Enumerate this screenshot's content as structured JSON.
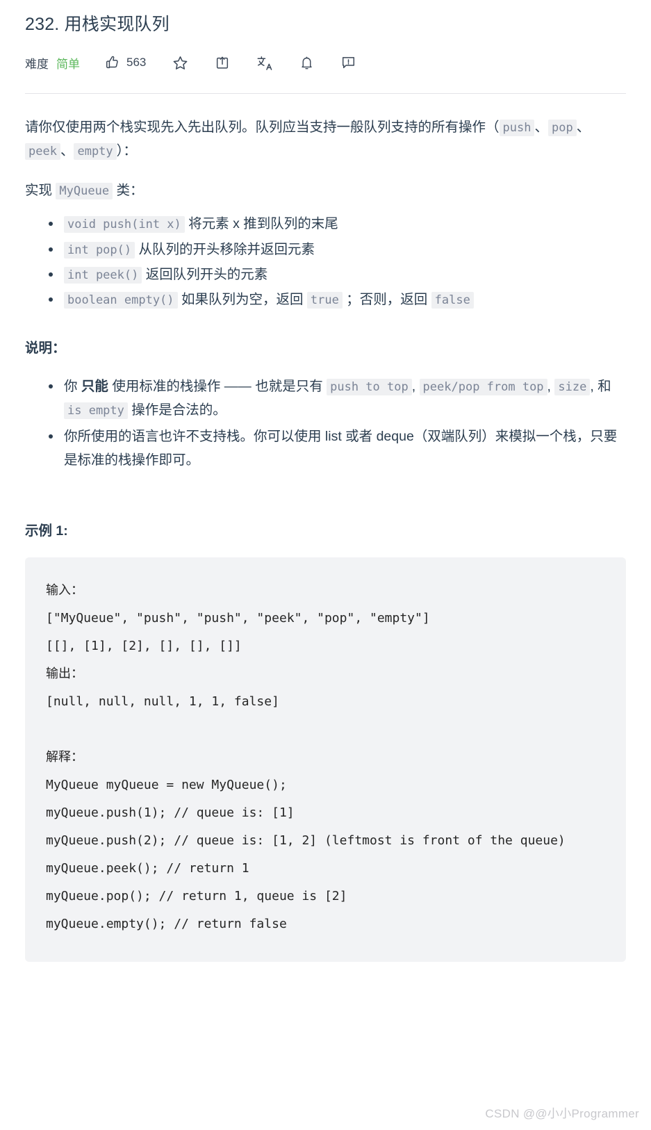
{
  "header": {
    "title": "232. 用栈实现队列",
    "difficulty_label": "难度",
    "difficulty_value": "简单",
    "difficulty_color": "#5cb85c",
    "like_count": "563",
    "icons": {
      "like": "thumbs-up-icon",
      "favorite": "star-icon",
      "share": "share-icon",
      "translate": "translate-icon",
      "notification": "bell-icon",
      "feedback": "comment-icon"
    }
  },
  "description": {
    "p1_a": "请你仅使用两个栈实现先入先出队列。队列应当支持一般队列支持的所有操作（",
    "p1_code1": "push",
    "p1_sep1": "、",
    "p1_code2": "pop",
    "p1_sep2": "、",
    "p1_code3": "peek",
    "p1_sep3": "、",
    "p1_code4": "empty",
    "p1_b": "）：",
    "p2_a": "实现 ",
    "p2_code": "MyQueue",
    "p2_b": " 类："
  },
  "methods": [
    {
      "code": "void push(int x)",
      "text": " 将元素 x 推到队列的末尾"
    },
    {
      "code": "int pop()",
      "text": " 从队列的开头移除并返回元素"
    },
    {
      "code": "int peek()",
      "text": " 返回队列开头的元素"
    }
  ],
  "method_empty": {
    "code": "boolean empty()",
    "text_a": " 如果队列为空，返回 ",
    "code_true": "true",
    "text_b": " ；否则，返回 ",
    "code_false": "false"
  },
  "notes": {
    "title": "说明：",
    "item1": {
      "a": "你 ",
      "bold": "只能",
      "b": " 使用标准的栈操作 —— 也就是只有 ",
      "code1": "push to top",
      "c": ", ",
      "code2": "peek/pop from top",
      "d": ", ",
      "code3": "size",
      "e": ", 和 ",
      "code4": "is empty",
      "f": " 操作是合法的。"
    },
    "item2": "你所使用的语言也许不支持栈。你可以使用 list 或者 deque（双端队列）来模拟一个栈，只要是标准的栈操作即可。"
  },
  "example": {
    "title": "示例 1:",
    "code": "输入：\n[\"MyQueue\", \"push\", \"push\", \"peek\", \"pop\", \"empty\"]\n[[], [1], [2], [], [], []]\n输出：\n[null, null, null, 1, 1, false]\n\n解释：\nMyQueue myQueue = new MyQueue();\nmyQueue.push(1); // queue is: [1]\nmyQueue.push(2); // queue is: [1, 2] (leftmost is front of the queue)\nmyQueue.peek(); // return 1\nmyQueue.pop(); // return 1, queue is [2]\nmyQueue.empty(); // return false"
  },
  "watermark": "CSDN @@小小Programmer"
}
